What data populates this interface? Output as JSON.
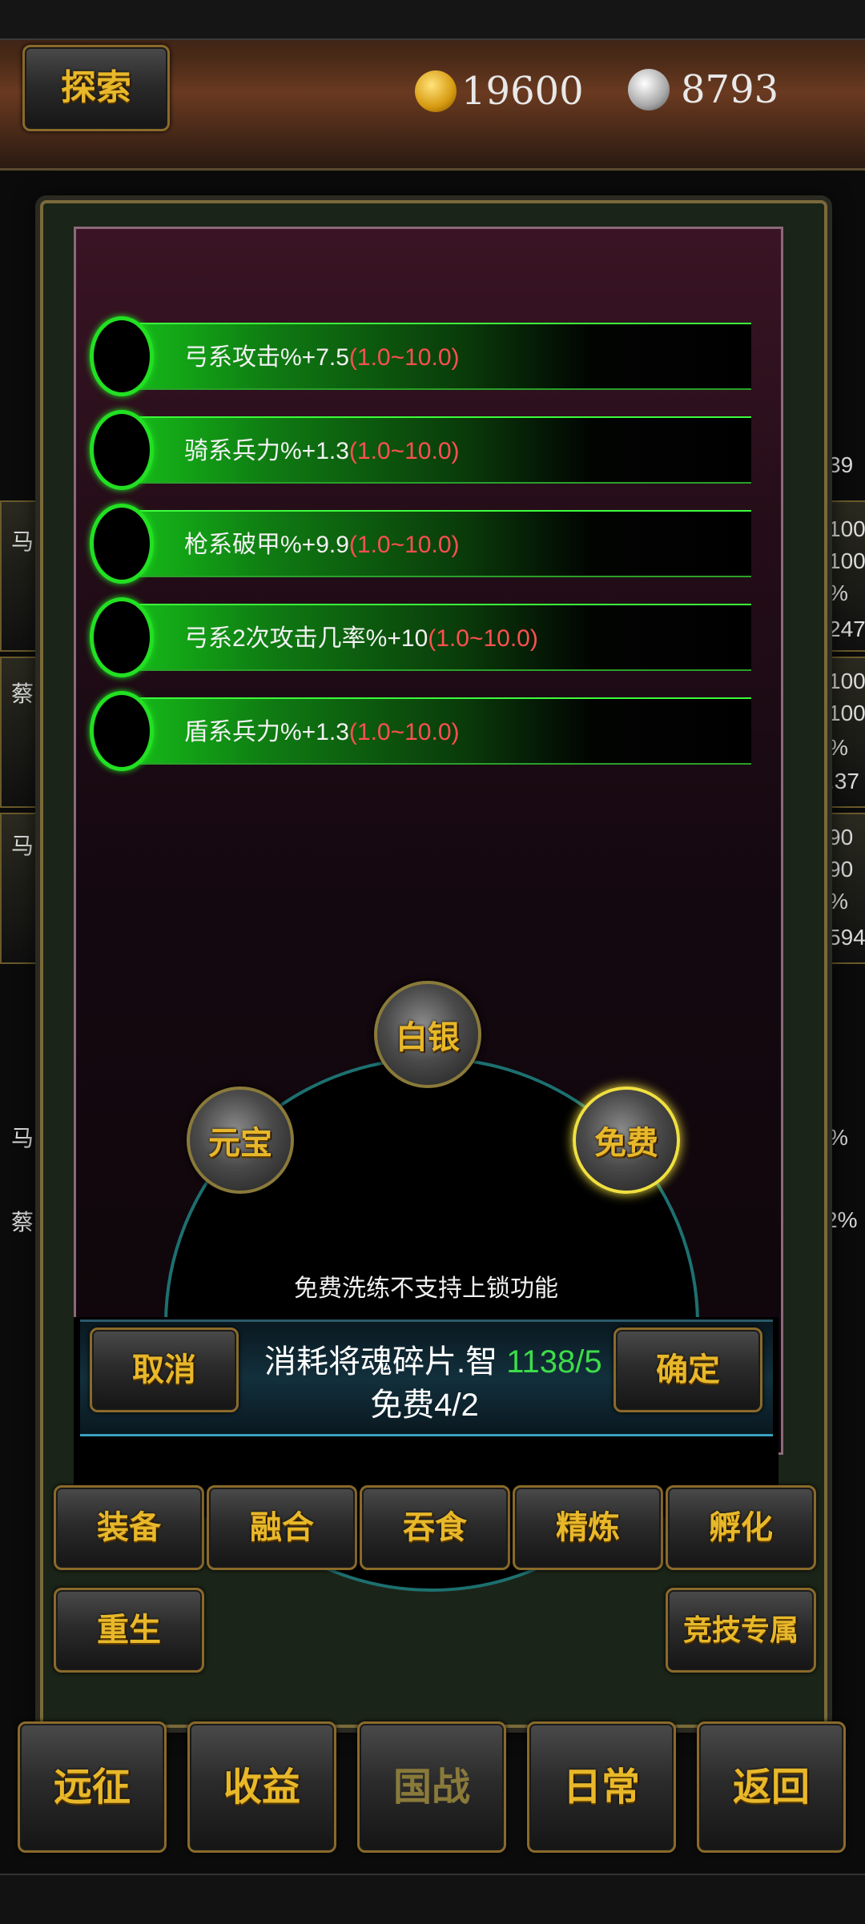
{
  "topbar": {
    "explore_label": "探索",
    "gold_value": "19600",
    "silver_value": "8793",
    "gold_icon": "gold-ingot-icon",
    "silver_icon": "silver-ingot-icon"
  },
  "background": {
    "left_names": [
      "马",
      "蔡",
      "马",
      "马",
      "蔡"
    ],
    "right_top": "39",
    "right_values": [
      "100",
      "100",
      "%",
      "247",
      "100",
      "100",
      "%",
      ".37",
      "90",
      "90",
      "%",
      "594"
    ],
    "right_percent_1": "%",
    "right_percent_2": "2%"
  },
  "modal": {
    "attributes": [
      {
        "text": "弓系攻击%+7.5",
        "range": "(1.0~10.0)"
      },
      {
        "text": "骑系兵力%+1.3",
        "range": "(1.0~10.0)"
      },
      {
        "text": "枪系破甲%+9.9",
        "range": "(1.0~10.0)"
      },
      {
        "text": "弓系2次攻击几率%+10",
        "range": "(1.0~10.0)"
      },
      {
        "text": "盾系兵力%+1.3",
        "range": "(1.0~10.0)"
      }
    ],
    "options": {
      "silver": "白银",
      "ingot": "元宝",
      "free": "免费"
    },
    "note": "免费洗练不支持上锁功能",
    "cancel_label": "取消",
    "confirm_label": "确定",
    "cost_label": "消耗将魂碎片.智",
    "cost_value": "1138/5",
    "free_count": "免费4/2"
  },
  "function_buttons": {
    "equip": "装备",
    "fuse": "融合",
    "devour": "吞食",
    "refine": "精炼",
    "hatch": "孵化",
    "rebirth": "重生",
    "arena": "竞技专属"
  },
  "nav": {
    "expedition": "远征",
    "income": "收益",
    "nation_war": "国战",
    "daily": "日常",
    "back": "返回"
  },
  "colors": {
    "gold_text": "#e8b82a",
    "attr_green": "#22e022",
    "range_red": "#ff5050",
    "cost_green": "#3ddc4a"
  }
}
